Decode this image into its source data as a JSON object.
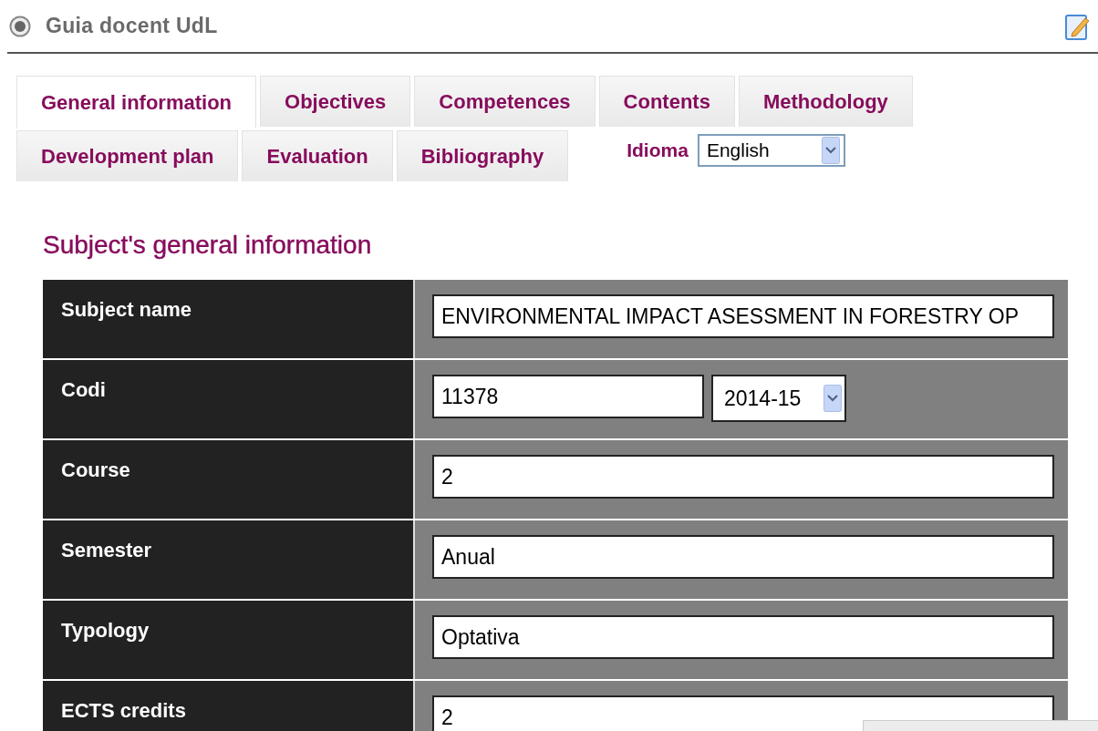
{
  "header": {
    "title": "Guia docent UdL"
  },
  "tabs": [
    {
      "label": "General information",
      "selected": true
    },
    {
      "label": "Objectives",
      "selected": false
    },
    {
      "label": "Competences",
      "selected": false
    },
    {
      "label": "Contents",
      "selected": false
    },
    {
      "label": "Methodology",
      "selected": false
    },
    {
      "label": "Development plan",
      "selected": false
    },
    {
      "label": "Evaluation",
      "selected": false
    },
    {
      "label": "Bibliography",
      "selected": false
    }
  ],
  "language": {
    "label": "Idioma",
    "value": "English"
  },
  "section_title": "Subject's general information",
  "fields": [
    {
      "kind": "text",
      "label": "Subject name",
      "value": "ENVIRONMENTAL IMPACT ASESSMENT IN FORESTRY OP"
    },
    {
      "kind": "code",
      "label": "Codi",
      "value": "11378",
      "year": "2014-15"
    },
    {
      "kind": "text",
      "label": "Course",
      "value": "2"
    },
    {
      "kind": "text",
      "label": "Semester",
      "value": "Anual"
    },
    {
      "kind": "text",
      "label": "Typology",
      "value": "Optativa"
    },
    {
      "kind": "text",
      "label": "ECTS credits",
      "value": "2"
    }
  ]
}
